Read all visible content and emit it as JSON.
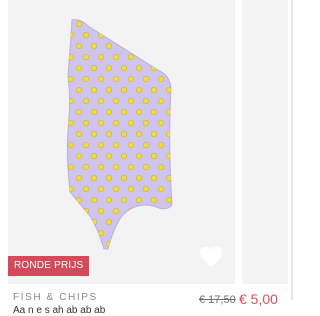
{
  "product": {
    "badge": "RONDE PRIJS",
    "brand": "FISH & CHIPS",
    "old_price": "€ 17,50",
    "new_price": "€ 5,00",
    "title_partial": "Aa n e s ah ab ab ab"
  },
  "icons": {
    "wishlist": "heart-outline-icon"
  },
  "colors": {
    "image_bg": "#f3f3f3",
    "swimsuit": "#cfc4ec",
    "pattern": "#f2dc3a",
    "badge_bg": "#d6495b",
    "sale_price": "#e24d5c",
    "brand_text": "#8a8a8a"
  }
}
